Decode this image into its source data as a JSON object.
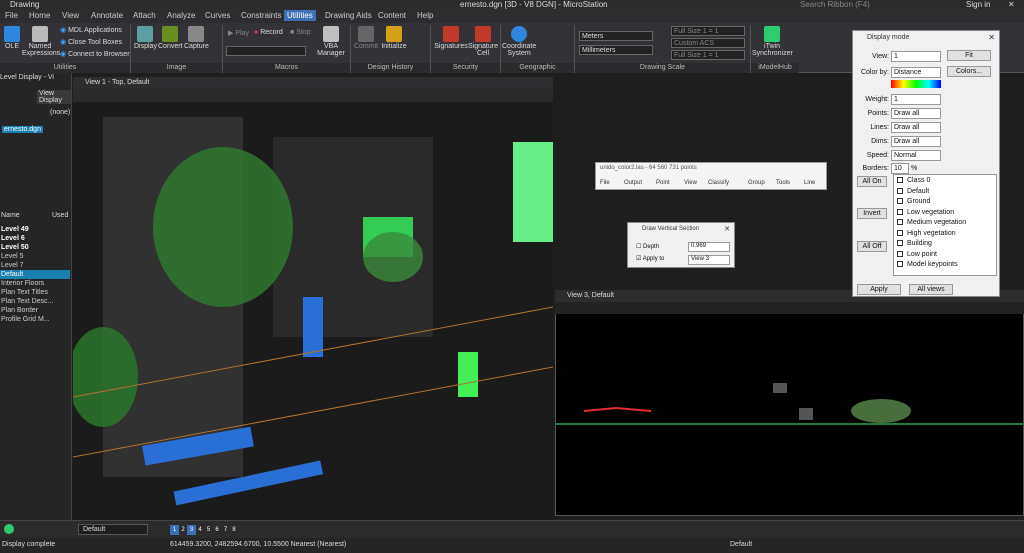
{
  "titlebar": {
    "app_menu": "Drawing",
    "title": "ernesto.dgn [3D - V8 DGN] - MicroStation",
    "search_placeholder": "Search Ribbon (F4)",
    "signin": "Sign in"
  },
  "menus": [
    "File",
    "Home",
    "View",
    "Annotate",
    "Attach",
    "Analyze",
    "Curves",
    "Constraints",
    "Utilities",
    "Drawing Aids",
    "Content",
    "Help"
  ],
  "active_menu": "Utilities",
  "ribbon": {
    "ole": "OLE",
    "named_expressions": "Named Expressions",
    "mdl": "MDL Applications",
    "close_tool_boxes": "Close Tool Boxes",
    "connect_browser": "Connect to Browser",
    "display": "Display",
    "convert": "Convert",
    "capture": "Capture",
    "play": "Play",
    "record": "Record",
    "stop": "Stop",
    "vba": "VBA Manager",
    "commit": "Commit",
    "initialize": "Initialize",
    "signatures": "Signatures",
    "signature_cell": "Signature Cell",
    "coordinate_system": "Coordinate System",
    "units1": "Meters",
    "units2": "Millimeters",
    "fullsize1": "Full Size 1 = 1",
    "custom_acs": "Custom ACS",
    "fullsize2": "Full Size 1 = 1",
    "itwin": "iTwin Synchronizer",
    "groups": {
      "utilities": "Utilities",
      "image": "Image",
      "macros": "Macros",
      "design_history": "Design History",
      "security": "Security",
      "geographic": "Geographic",
      "drawing_scale": "Drawing Scale",
      "imodelhub": "iModelHub"
    }
  },
  "leftpanel": {
    "title": "Level Display - Vi",
    "view_display": "View Display",
    "none": "(none)",
    "file": "ernesto.dgn",
    "col_name": "Name",
    "col_used": "Used",
    "layers": [
      "Level 49",
      "Level 6",
      "Level 50",
      "Level 5",
      "Level 7",
      "Default",
      "Interior Floors",
      "Plan Text Titles",
      "Plan Text Desc...",
      "Plan Border",
      "Profile Grid M..."
    ]
  },
  "view1": {
    "title": "View 1 - Top, Default"
  },
  "view3": {
    "title": "View 3, Default"
  },
  "pointcloud": {
    "title": "unido_color2.las - 64 560 731 points",
    "menu": [
      "File",
      "Output",
      "Point",
      "View",
      "Classify",
      "Group",
      "Tools",
      "Line"
    ]
  },
  "dvs": {
    "title": "Draw Vertical Section",
    "depth_label": "Depth",
    "depth_value": "0.969",
    "apply_label": "Apply to",
    "apply_value": "View 3"
  },
  "displaymode": {
    "title": "Display mode",
    "view_label": "View:",
    "view_value": "1",
    "fit": "Fit",
    "colorby_label": "Color by:",
    "colorby_value": "Distance",
    "colors": "Colors...",
    "weight_label": "Weight:",
    "weight_value": "1",
    "points_label": "Points:",
    "points_value": "Draw all",
    "lines_label": "Lines:",
    "lines_value": "Draw all",
    "dims_label": "Dims:",
    "dims_value": "Draw all",
    "speed_label": "Speed:",
    "speed_value": "Normal",
    "borders_label": "Borders:",
    "borders_value": "10",
    "borders_unit": "%",
    "all_on": "All On",
    "invert": "Invert",
    "all_off": "All Off",
    "classes": [
      "Class 0",
      "Default",
      "Ground",
      "Low vegetation",
      "Medium vegetation",
      "High vegetation",
      "Building",
      "Low point",
      "Model keypoints"
    ],
    "apply": "Apply",
    "all_views": "All views"
  },
  "bottombar": {
    "level": "Default",
    "views": [
      "1",
      "2",
      "3",
      "4",
      "5",
      "6",
      "7",
      "8"
    ]
  },
  "status": {
    "left": "Display complete",
    "coords": "614459.3200, 2482594.6700, 10.5500 Nearest (Nearest)",
    "level": "Default"
  }
}
